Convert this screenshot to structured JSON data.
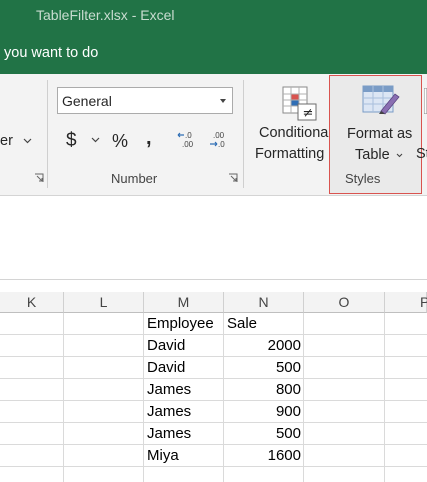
{
  "window": {
    "title": "TableFilter.xlsx  -  Excel"
  },
  "tellme": {
    "text": "you want to do"
  },
  "ribbon": {
    "alignment_partial": "er",
    "number": {
      "format_value": "General",
      "currency_symbol": "$",
      "percent_symbol": "%",
      "comma_symbol": ",",
      "increase_decimal": "←.0\n.00",
      "decrease_decimal": ".00\n→.0",
      "group_label": "Number"
    },
    "styles": {
      "conditional_line1": "Conditional",
      "conditional_line2": "Formatting",
      "format_table_line1": "Format as",
      "format_table_line2": "Table",
      "cell_styles_partial": "St",
      "group_label": "Styles"
    }
  },
  "sheet": {
    "columns": [
      "K",
      "L",
      "M",
      "N",
      "O",
      "P"
    ],
    "headers": {
      "employee": "Employee",
      "sale": "Sale"
    },
    "rows": [
      {
        "employee": "David",
        "sale": "2000"
      },
      {
        "employee": "David",
        "sale": "500"
      },
      {
        "employee": "James",
        "sale": "800"
      },
      {
        "employee": "James",
        "sale": "900"
      },
      {
        "employee": "James",
        "sale": "500"
      },
      {
        "employee": "Miya",
        "sale": "1600"
      }
    ]
  }
}
